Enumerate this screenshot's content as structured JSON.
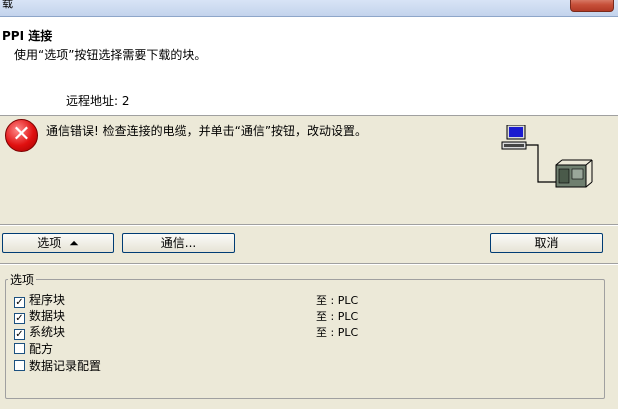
{
  "window": {
    "title_fragment": "载"
  },
  "header": {
    "title": "PPI 连接",
    "description": "使用“选项”按钮选择需要下载的块。"
  },
  "remote": {
    "label": "远程地址: 2"
  },
  "error": {
    "message": "通信错误!  检查连接的电缆，并单击“通信”按钮，改动设置。"
  },
  "buttons": {
    "options": "选项 ≛",
    "options_text": "选项",
    "options_arrow": "⏶",
    "communication": "通信...",
    "cancel": "取消"
  },
  "options_group": {
    "legend": "选项",
    "items": [
      {
        "label": "程序块",
        "checked": true,
        "target": "至 : PLC"
      },
      {
        "label": "数据块",
        "checked": true,
        "target": "至 : PLC"
      },
      {
        "label": "系统块",
        "checked": true,
        "target": "至 : PLC"
      },
      {
        "label": "配方",
        "checked": false,
        "target": ""
      },
      {
        "label": "数据记录配置",
        "checked": false,
        "target": ""
      }
    ]
  },
  "colors": {
    "error_red": "#e01010",
    "accent_border": "#003c74"
  },
  "icons": [
    "error-icon",
    "computer-icon",
    "plc-icon",
    "up-arrow-icon",
    "check-icon"
  ]
}
